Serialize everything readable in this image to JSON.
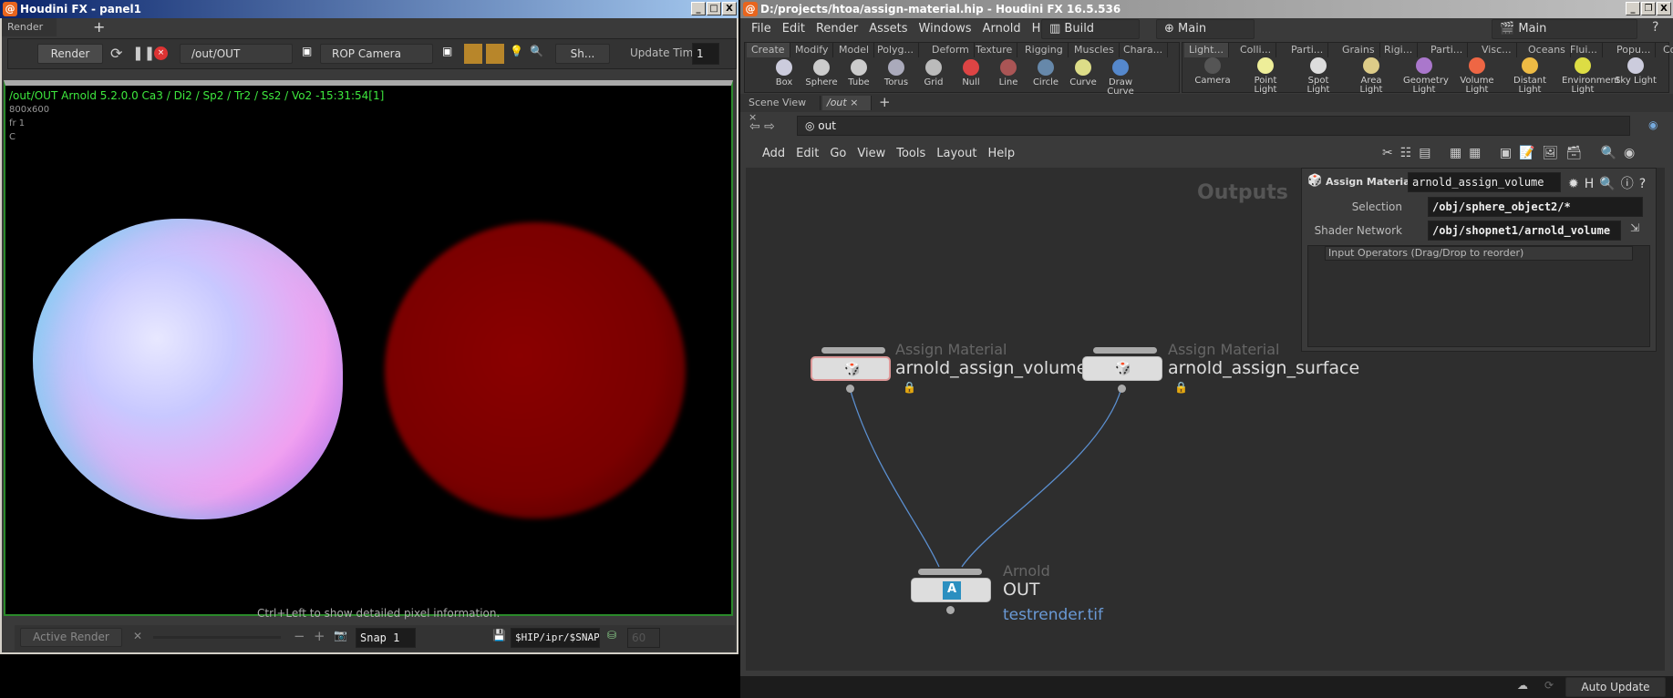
{
  "left_window": {
    "title": "Houdini FX - panel1",
    "tab": "Render View",
    "toolbar": {
      "render_label": "Render",
      "rop_path": "/out/OUT",
      "camera": "ROP Camera",
      "shading": "Sh...",
      "update_time_label": "Update Time",
      "update_time_value": "1"
    },
    "overlay": {
      "header": "/out/OUT  Arnold 5.2.0.0  Ca3 / Di2 / Sp2 / Tr2 / Ss2 / Vo2 -15:31:54[1]",
      "resolution": "800x600",
      "frame": "fr 1",
      "channel": "C",
      "hint": "Ctrl+Left to show detailed pixel information."
    },
    "bottom": {
      "active_render": "Active Render",
      "snap_name": "Snap 1",
      "snap_path": "$HIP/ipr/$SNAPNAME.$F",
      "fps": "60"
    }
  },
  "right_window": {
    "title": "D:/projects/htoa/assign-material.hip - Houdini FX 16.5.536",
    "menu": [
      "File",
      "Edit",
      "Render",
      "Assets",
      "Windows",
      "Arnold",
      "Help"
    ],
    "desktop": "Build",
    "network_desktop": "Main",
    "takes": "Main",
    "shelf_tabs_left": [
      "Create",
      "Modify",
      "Model",
      "Polyg...",
      "Deform",
      "Texture",
      "Rigging",
      "Muscles",
      "Chara..."
    ],
    "shelf_tools_left": [
      "Box",
      "Sphere",
      "Tube",
      "Torus",
      "Grid",
      "Null",
      "Line",
      "Circle",
      "Curve",
      "Draw Curve"
    ],
    "shelf_tabs_right": [
      "Light...",
      "Colli...",
      "Parti...",
      "Grains",
      "Rigi...",
      "Parti...",
      "Visc...",
      "Oceans",
      "Flui...",
      "Popu...",
      "Cont..."
    ],
    "shelf_tools_right": [
      "Camera",
      "Point Light",
      "Spot Light",
      "Area Light",
      "Geometry Light",
      "Volume Light",
      "Distant Light",
      "Environment Light",
      "Sky Light"
    ],
    "pane_tabs": [
      "Scene View",
      "/out"
    ],
    "path": "out",
    "network_menu": [
      "Add",
      "Edit",
      "Go",
      "View",
      "Tools",
      "Layout",
      "Help"
    ],
    "context_label": "Outputs",
    "nodes": [
      {
        "type": "Assign Material",
        "name": "arnold_assign_volume",
        "selected": true
      },
      {
        "type": "Assign Material",
        "name": "arnold_assign_surface",
        "selected": false
      },
      {
        "type": "Arnold",
        "name": "OUT",
        "output": "testrender.tif"
      }
    ],
    "params": {
      "node_type": "Assign Material",
      "node_name": "arnold_assign_volume",
      "selection_label": "Selection",
      "selection": "/obj/sphere_object2/*",
      "shader_label": "Shader Network",
      "shader": "/obj/shopnet1/arnold_volume",
      "input_ops": "Input Operators (Drag/Drop to reorder)"
    },
    "status": {
      "auto_update": "Auto Update"
    }
  },
  "colors": {
    "overlay_green": "#3ee83e",
    "wire": "#5b8fd0",
    "output_link": "#6a9ad6",
    "accent": "#e8651e"
  }
}
